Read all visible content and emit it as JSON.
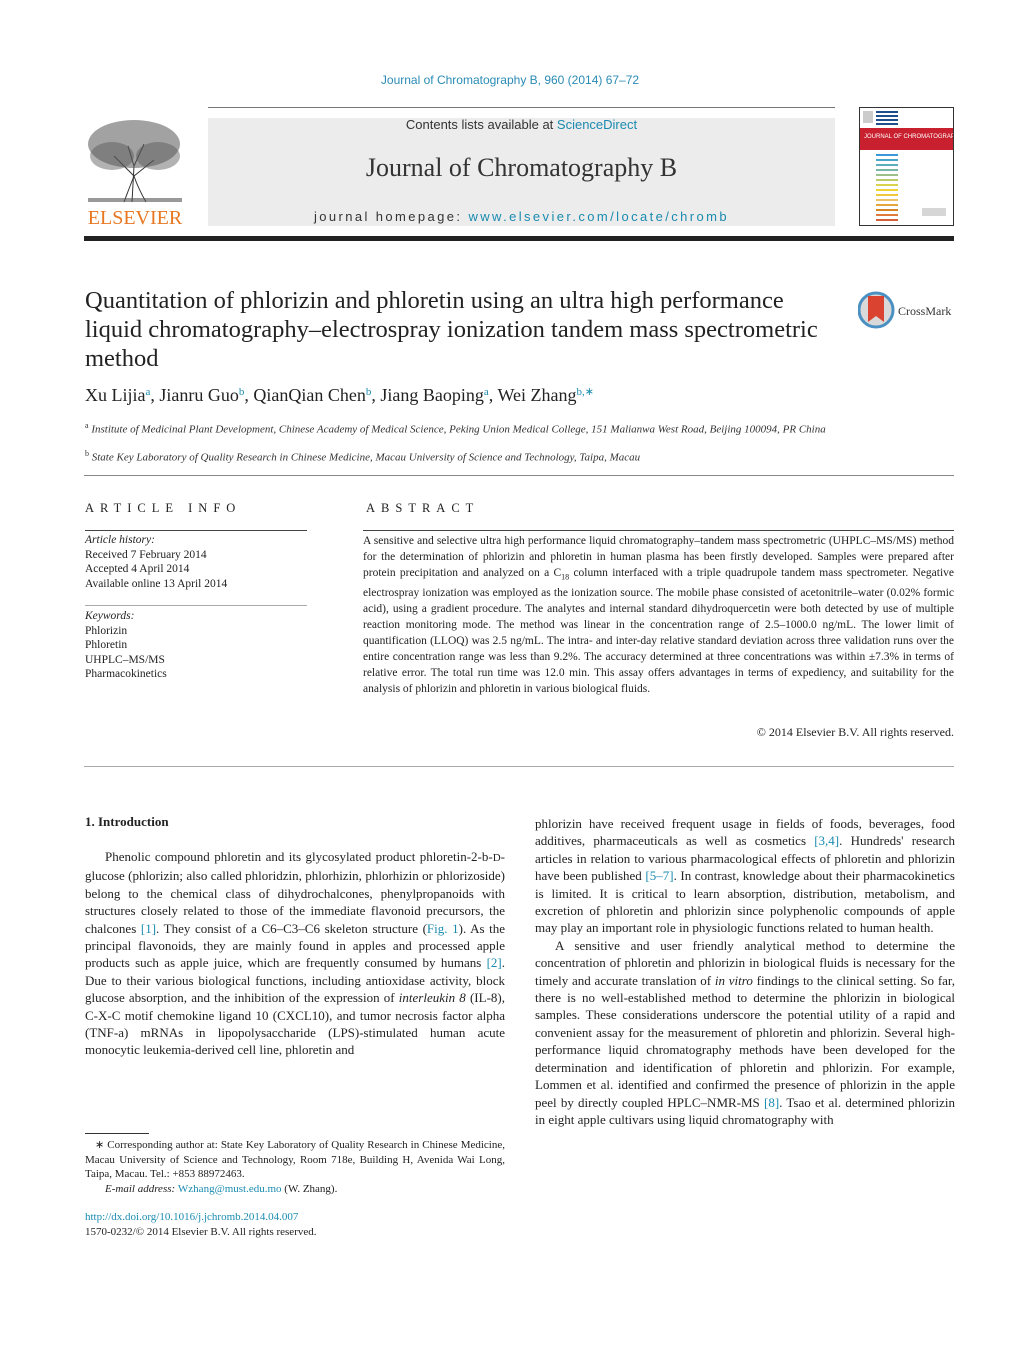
{
  "header": {
    "citation": "Journal of Chromatography B, 960 (2014) 67–72",
    "contents_prefix": "Contents lists available at ",
    "contents_link": "ScienceDirect",
    "journal_name": "Journal of Chromatography B",
    "homepage_prefix": "journal homepage: ",
    "homepage_link": "www.elsevier.com/locate/chromb",
    "publisher_logo": "ELSEVIER",
    "cover_title": "JOURNAL OF CHROMATOGRAPHY B",
    "crossmark_label": "CrossMark"
  },
  "article": {
    "title": "Quantitation of phlorizin and phloretin using an ultra high performance liquid chromatography–electrospray ionization tandem mass spectrometric method",
    "authors": [
      {
        "name": "Xu Lijia",
        "aff": "a"
      },
      {
        "name": "Jianru Guo",
        "aff": "b"
      },
      {
        "name": "QianQian Chen",
        "aff": "b"
      },
      {
        "name": "Jiang Baoping",
        "aff": "a"
      },
      {
        "name": "Wei Zhang",
        "aff": "b,∗"
      }
    ],
    "affiliations": [
      {
        "mark": "a",
        "text": "Institute of Medicinal Plant Development, Chinese Academy of Medical Science, Peking Union Medical College, 151 Malianwa West Road, Beijing 100094, PR China"
      },
      {
        "mark": "b",
        "text": "State Key Laboratory of Quality Research in Chinese Medicine, Macau University of Science and Technology, Taipa, Macau"
      }
    ]
  },
  "article_info": {
    "heading": "ARTICLE INFO",
    "history_label": "Article history:",
    "history": [
      "Received 7 February 2014",
      "Accepted 4 April 2014",
      "Available online 13 April 2014"
    ],
    "keywords_label": "Keywords:",
    "keywords": [
      "Phlorizin",
      "Phloretin",
      "UHPLC–MS/MS",
      "Pharmacokinetics"
    ]
  },
  "abstract": {
    "heading": "ABSTRACT",
    "text_1": "A sensitive and selective ultra high performance liquid chromatography–tandem mass spectrometric (UHPLC–MS/MS) method for the determination of phlorizin and phloretin in human plasma has been firstly developed. Samples were prepared after protein precipitation and analyzed on a C",
    "subscript": "18",
    "text_2": " column interfaced with a triple quadrupole tandem mass spectrometer. Negative electrospray ionization was employed as the ionization source. The mobile phase consisted of acetonitrile–water (0.02% formic acid), using a gradient procedure. The analytes and internal standard dihydroquercetin were both detected by use of multiple reaction monitoring mode. The method was linear in the concentration range of 2.5–1000.0 ng/mL. The lower limit of quantification (LLOQ) was 2.5 ng/mL. The intra- and inter-day relative standard deviation across three validation runs over the entire concentration range was less than 9.2%. The accuracy determined at three concentrations was within ±7.3% in terms of relative error. The total run time was 12.0 min. This assay offers advantages in terms of expediency, and suitability for the analysis of phlorizin and phloretin in various biological fluids.",
    "copyright": "© 2014 Elsevier B.V. All rights reserved."
  },
  "introduction": {
    "heading": "1.  Introduction",
    "left_p1": [
      "Phenolic compound phloretin and its glycosylated product phloretin-2-b-",
      "D",
      "-glucose (phlorizin; also called phloridzin, phlorhizin, phlorhizin or phlorizoside) belong to the chemical class of dihydrochalcones, phenylpropanoids with structures closely related to those of the immediate flavonoid precursors, the chalcones ",
      "[1]",
      ". They consist of a C6–C3–C6 skeleton structure (",
      "Fig. 1",
      "). As the principal flavonoids, they are mainly found in apples and processed apple products such as apple juice, which are frequently consumed by humans ",
      "[2]",
      ". Due to their various biological functions, including antioxidase activity, block glucose absorption, and the inhibition of the expression of ",
      "interleukin 8",
      " (IL-8), C-X-C motif chemokine ligand 10 (CXCL10), and tumor necrosis factor alpha (TNF-a) mRNAs in lipopolysaccharide (LPS)-stimulated human acute monocytic leukemia-derived cell line, phloretin and"
    ],
    "right_p1": [
      "phlorizin have received frequent usage in fields of foods, beverages, food additives, pharmaceuticals as well as cosmetics ",
      "[3,4]",
      ". Hundreds' research articles in relation to various pharmacological effects of phloretin and phlorizin have been published ",
      "[5–7]",
      ". In contrast, knowledge about their pharmacokinetics is limited. It is critical to learn absorption, distribution, metabolism, and excretion of phloretin and phlorizin since polyphenolic compounds of apple may play an important role in physiologic functions related to human health."
    ],
    "right_p2": [
      "A sensitive and user friendly analytical method to determine the concentration of phloretin and phlorizin in biological fluids is necessary for the timely and accurate translation of ",
      "in vitro",
      " findings to the clinical setting. So far, there is no well-established method to determine the phlorizin in biological samples. These considerations underscore the potential utility of a rapid and convenient assay for the measurement of phloretin and phlorizin. Several high-performance liquid chromatography methods have been developed for the determination and identification of phloretin and phlorizin. For example, Lommen et al. identified and confirmed the presence of phlorizin in the apple peel by directly coupled HPLC–NMR-MS ",
      "[8]",
      ". Tsao et al. determined phlorizin in eight apple cultivars using liquid chromatography with"
    ]
  },
  "footnote": {
    "corresponding": "∗ Corresponding author at: State Key Laboratory of Quality Research in Chinese Medicine, Macau University of Science and Technology, Room 718e, Building H, Avenida Wai Long, Taipa, Macau. Tel.: +853 88972463.",
    "email_label": "E-mail address: ",
    "email": "Wzhang@must.edu.mo",
    "email_suffix": " (W. Zhang).",
    "doi": "http://dx.doi.org/10.1016/j.jchromb.2014.04.007",
    "issn": "1570-0232/© 2014 Elsevier B.V. All rights reserved."
  }
}
